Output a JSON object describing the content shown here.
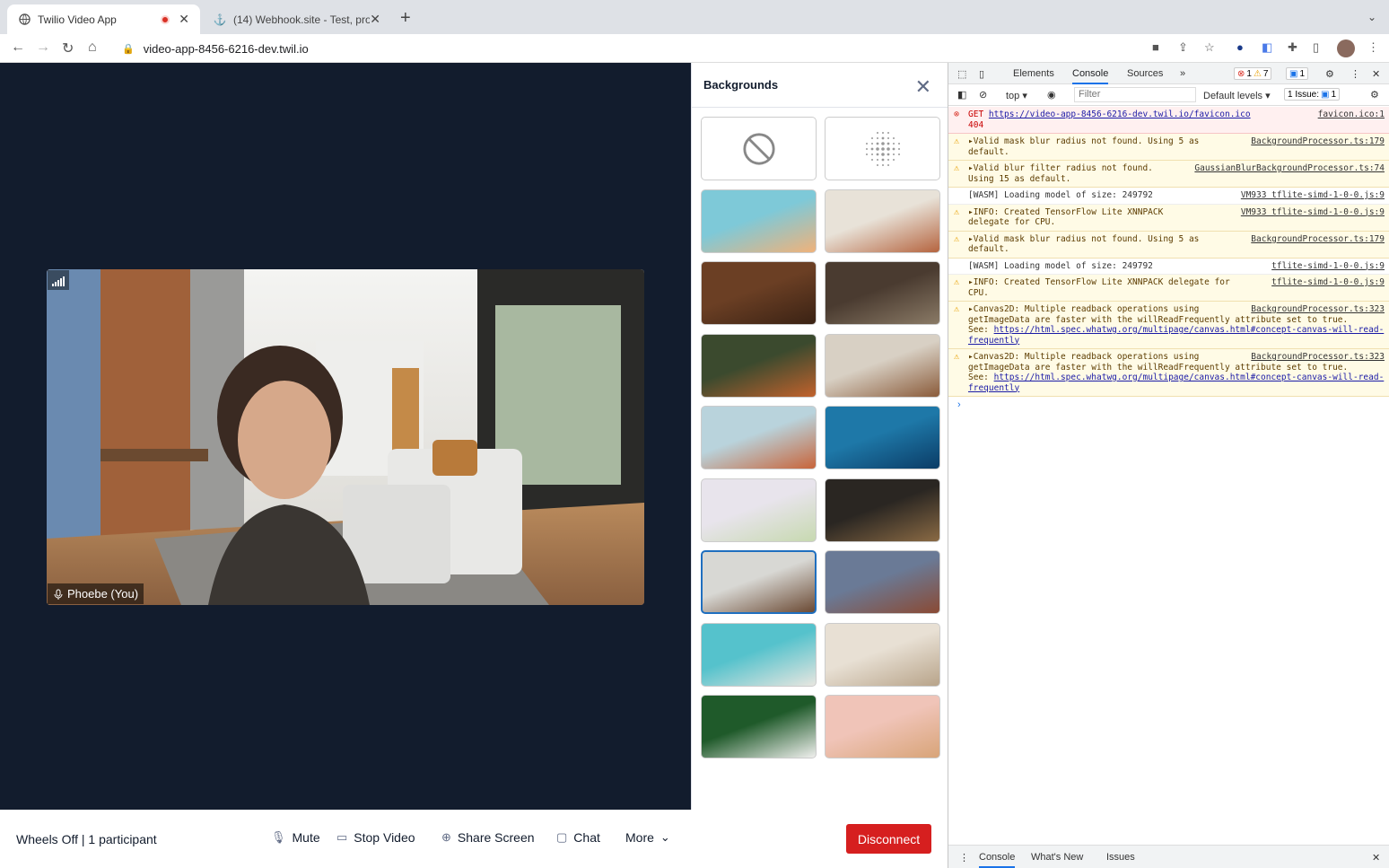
{
  "browser": {
    "tabs": [
      {
        "title": "Twilio Video App",
        "recording": true
      },
      {
        "title": "(14) Webhook.site - Test, proc"
      }
    ],
    "address": "video-app-8456-6216-dev.twil.io"
  },
  "video": {
    "participant_label": "Phoebe (You)"
  },
  "backgrounds_panel": {
    "title": "Backgrounds",
    "thumbnails": [
      {
        "name": "none",
        "kind": "option"
      },
      {
        "name": "blur",
        "kind": "option"
      },
      {
        "name": "abstract",
        "colors": [
          "#7ec9d8",
          "#f0b27a"
        ]
      },
      {
        "name": "boho-home",
        "colors": [
          "#e8e2d8",
          "#b5643f"
        ]
      },
      {
        "name": "bookshelf",
        "colors": [
          "#6b3f24",
          "#3a2214"
        ]
      },
      {
        "name": "coffee-shop",
        "colors": [
          "#4a3b30",
          "#8a7a66"
        ]
      },
      {
        "name": "modern-home",
        "colors": [
          "#3b4a2e",
          "#c2622d"
        ]
      },
      {
        "name": "living-room",
        "colors": [
          "#d8d0c4",
          "#8a5b3a"
        ]
      },
      {
        "name": "desert",
        "colors": [
          "#b9d3dc",
          "#c8643a"
        ]
      },
      {
        "name": "ocean",
        "colors": [
          "#1e78a8",
          "#0b3c66"
        ]
      },
      {
        "name": "flowers",
        "colors": [
          "#e8e4ec",
          "#c7d9b0"
        ]
      },
      {
        "name": "kitchen",
        "colors": [
          "#2a2622",
          "#8a6a44"
        ]
      },
      {
        "name": "apartment",
        "colors": [
          "#d8d8d4",
          "#6b4a34"
        ],
        "selected": true
      },
      {
        "name": "mountains",
        "colors": [
          "#6a7a96",
          "#8a4a34"
        ]
      },
      {
        "name": "beach",
        "colors": [
          "#55c2cc",
          "#e8e6e0"
        ]
      },
      {
        "name": "dining-room",
        "colors": [
          "#e8e0d4",
          "#b8a48a"
        ]
      },
      {
        "name": "leaves",
        "colors": [
          "#1f5a2a",
          "#f0f0ee"
        ]
      },
      {
        "name": "golden-gate",
        "colors": [
          "#f0c4b8",
          "#d8a478"
        ]
      }
    ]
  },
  "bottom_bar": {
    "room_info": "Wheels Off | 1 participant",
    "mute": "Mute",
    "stop_video": "Stop Video",
    "share_screen": "Share Screen",
    "chat": "Chat",
    "more": "More",
    "disconnect": "Disconnect",
    "disconnect_color": "#d61f1f"
  },
  "devtools": {
    "tabs": [
      "Elements",
      "Console",
      "Sources"
    ],
    "errors": "1",
    "warnings": "7",
    "messages": "1",
    "context": "top",
    "filter_placeholder": "Filter",
    "levels": "Default levels",
    "issues": "1 Issue:",
    "issues_count": "1",
    "logs": [
      {
        "level": "error",
        "prefix": "GET ",
        "link": "https://video-app-8456-6216-dev.twil.io/favicon.ico",
        "rest": "\n404",
        "source": "favicon.ico:1"
      },
      {
        "level": "warn",
        "text": "▸Valid mask blur radius not found. Using 5 as\ndefault.",
        "source": "BackgroundProcessor.ts:179"
      },
      {
        "level": "warn",
        "text": "▸Valid blur filter radius not found.\nUsing 15 as default.",
        "source": "GaussianBlurBackgroundProcessor.ts:74"
      },
      {
        "level": "info",
        "text": "[WASM] Loading model of size: 249792",
        "source": "VM933 tflite-simd-1-0-0.js:9"
      },
      {
        "level": "warn",
        "text": "▸INFO: Created TensorFlow Lite XNNPACK\ndelegate for CPU.",
        "source": "VM933 tflite-simd-1-0-0.js:9"
      },
      {
        "level": "warn",
        "text": "▸Valid mask blur radius not found. Using 5 as\ndefault.",
        "source": "BackgroundProcessor.ts:179"
      },
      {
        "level": "info",
        "text": "[WASM] Loading model of size: 249792",
        "source": "tflite-simd-1-0-0.js:9"
      },
      {
        "level": "warn",
        "text": "▸INFO: Created TensorFlow Lite XNNPACK delegate for\nCPU.",
        "source": "tflite-simd-1-0-0.js:9"
      },
      {
        "level": "warn",
        "text": "▸Canvas2D: Multiple readback operations using\ngetImageData are faster with the willReadFrequently attribute set to true.\nSee: ",
        "link": "https://html.spec.whatwg.org/multipage/canvas.html#concept-canvas-will-read-frequently",
        "source": "BackgroundProcessor.ts:323"
      },
      {
        "level": "warn",
        "text": "▸Canvas2D: Multiple readback operations using\ngetImageData are faster with the willReadFrequently attribute set to true.\nSee: ",
        "link": "https://html.spec.whatwg.org/multipage/canvas.html#concept-canvas-will-read-frequently",
        "source": "BackgroundProcessor.ts:323"
      }
    ],
    "drawer_tabs": [
      "Console",
      "What's New",
      "Issues"
    ]
  }
}
